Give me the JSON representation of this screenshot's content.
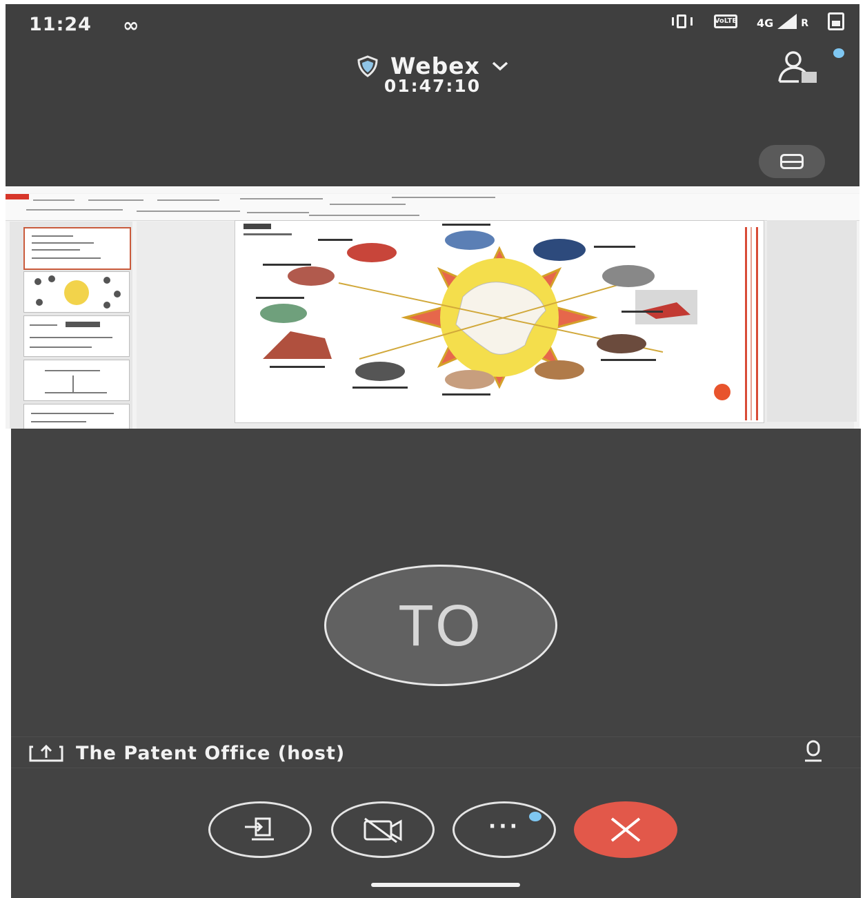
{
  "status_bar": {
    "time": "11:24",
    "left_icon": "∞",
    "volte_label": "VoLTE",
    "network_label": "4G",
    "roaming_label": "R"
  },
  "header": {
    "app_title": "Webex",
    "call_timer": "01:47:10"
  },
  "shared_content": {
    "description": "PowerPoint presentation being shared",
    "slide_count_visible": 5
  },
  "participant": {
    "initials": "TO",
    "name": "The Patent Office (host)"
  },
  "controls": {
    "more_label": "···"
  },
  "colors": {
    "background_dark": "#434343",
    "end_call_red": "#e2584a",
    "notification_dot": "#7fc7f2"
  },
  "icons": [
    "infinity-icon",
    "vibrate-icon",
    "volte-icon",
    "signal-icon",
    "battery-icon",
    "shield-icon",
    "chevron-down-icon",
    "participants-icon",
    "layout-icon",
    "share-screen-icon",
    "mic-icon",
    "move-to-device-icon",
    "video-off-icon",
    "more-icon",
    "close-icon"
  ]
}
